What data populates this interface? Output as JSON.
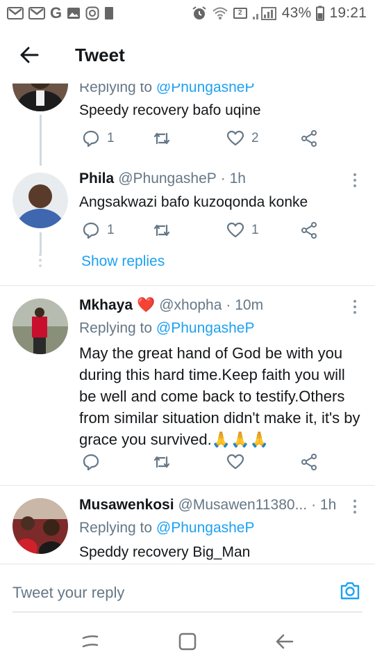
{
  "status_bar": {
    "left_icons": [
      "gmail-icon",
      "gmail-icon",
      "google-icon",
      "gallery-icon",
      "instagram-icon",
      "notification-icon"
    ],
    "battery_percent": "43%",
    "time": "19:21",
    "sim_badge": "2"
  },
  "header": {
    "title": "Tweet",
    "back_icon": "arrow-left-icon"
  },
  "tweets": [
    {
      "reply_to_prefix": "Replying to ",
      "reply_to_handle": "@PhungasheP",
      "text": "Speedy recovery bafo uqine",
      "replies": "1",
      "retweets": "",
      "likes": "2"
    },
    {
      "name": "Phila",
      "handle": "@PhungasheP",
      "time": "· 1h",
      "text": "Angsakwazi bafo kuzoqonda konke",
      "replies": "1",
      "retweets": "",
      "likes": "1",
      "show_replies": "Show replies"
    },
    {
      "name": "Mkhaya",
      "emoji": "❤️",
      "handle": "@xhopha",
      "time": "· 10m",
      "reply_to_prefix": "Replying to ",
      "reply_to_handle": "@PhungasheP",
      "text": "May the great hand of God be with you during this hard time.Keep faith you will be well and come back to testify.Others from similar situation didn't make it, it's by grace you survived.🙏🙏🙏",
      "replies": "",
      "retweets": "",
      "likes": ""
    },
    {
      "name": "Musawenkosi",
      "handle": "@Musawen11380...",
      "time": "· 1h",
      "reply_to_prefix": "Replying to ",
      "reply_to_handle": "@PhungasheP",
      "text": "Speddy recovery Big_Man"
    }
  ],
  "composer": {
    "placeholder": "Tweet your reply",
    "camera_icon": "camera-icon"
  },
  "nav_bar": {
    "icons": [
      "recent-apps-icon",
      "home-icon",
      "back-icon"
    ]
  },
  "colors": {
    "accent": "#1da1f2",
    "secondary_text": "#657786",
    "divider": "#e1e8ed",
    "heart": "#e0245e"
  }
}
